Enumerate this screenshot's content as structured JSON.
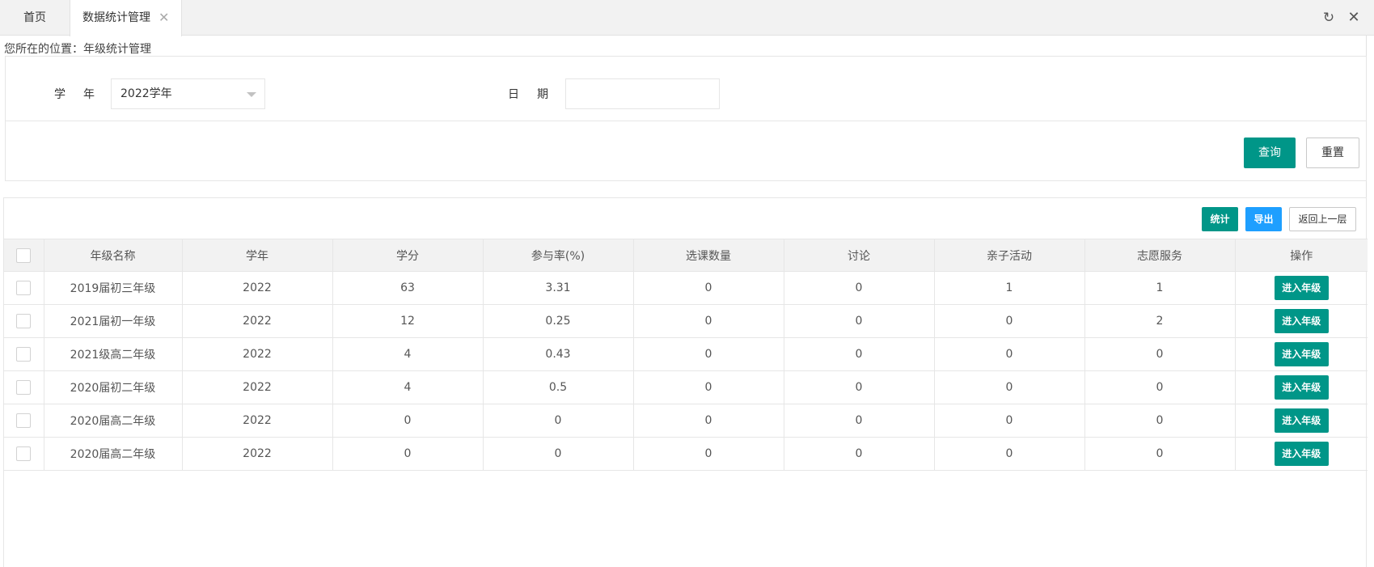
{
  "tabs": {
    "home": "首页",
    "active": "数据统计管理",
    "close_glyph": "✕"
  },
  "toolbar_icons": {
    "refresh": "↻",
    "close": "✕"
  },
  "breadcrumb": "您所在的位置：年级统计管理",
  "search": {
    "year_label": "学年",
    "year_value": "2022学年",
    "date_label": "日期",
    "date_value": "",
    "query_label": "查询",
    "reset_label": "重置"
  },
  "actions": {
    "stat_label": "统计",
    "export_label": "导出",
    "back_label": "返回上一层"
  },
  "table": {
    "columns": [
      "年级名称",
      "学年",
      "学分",
      "参与率(%)",
      "选课数量",
      "讨论",
      "亲子活动",
      "志愿服务",
      "操作"
    ],
    "rows": [
      {
        "name": "2019届初三年级",
        "year": "2022",
        "credits": "63",
        "rate": "3.31",
        "courses": "0",
        "discussion": "0",
        "parent": "1",
        "volunteer": "1",
        "action": "进入年级"
      },
      {
        "name": "2021届初一年级",
        "year": "2022",
        "credits": "12",
        "rate": "0.25",
        "courses": "0",
        "discussion": "0",
        "parent": "0",
        "volunteer": "2",
        "action": "进入年级"
      },
      {
        "name": "2021级高二年级",
        "year": "2022",
        "credits": "4",
        "rate": "0.43",
        "courses": "0",
        "discussion": "0",
        "parent": "0",
        "volunteer": "0",
        "action": "进入年级"
      },
      {
        "name": "2020届初二年级",
        "year": "2022",
        "credits": "4",
        "rate": "0.5",
        "courses": "0",
        "discussion": "0",
        "parent": "0",
        "volunteer": "0",
        "action": "进入年级"
      },
      {
        "name": "2020届高二年级",
        "year": "2022",
        "credits": "0",
        "rate": "0",
        "courses": "0",
        "discussion": "0",
        "parent": "0",
        "volunteer": "0",
        "action": "进入年级"
      },
      {
        "name": "2020届高二年级",
        "year": "2022",
        "credits": "0",
        "rate": "0",
        "courses": "0",
        "discussion": "0",
        "parent": "0",
        "volunteer": "0",
        "action": "进入年级"
      }
    ]
  },
  "colors": {
    "primary": "#009688",
    "export": "#1e9fff"
  }
}
